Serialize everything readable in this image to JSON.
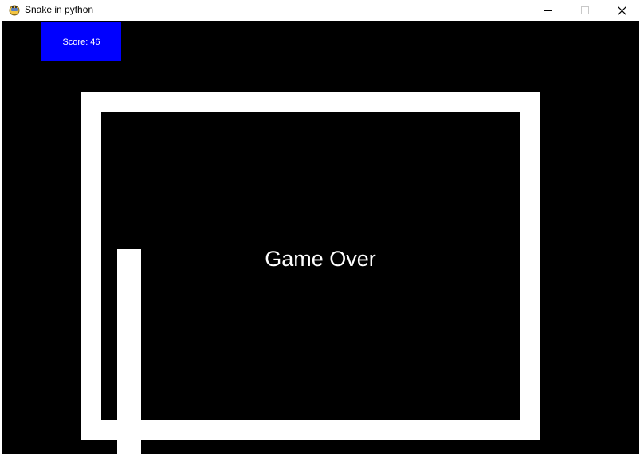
{
  "window": {
    "title": "Snake in python",
    "app_icon": "python-snake-icon",
    "controls": {
      "minimize_icon": "minimize-icon",
      "maximize_icon": "maximize-icon",
      "close_icon": "close-icon"
    }
  },
  "game": {
    "score_label": "Score: 46",
    "score_value": 46,
    "status_text": "Game Over",
    "colors": {
      "background": "#000000",
      "score_panel": "#0000ff",
      "walls": "#ffffff",
      "snake": "#ffffff",
      "text": "#ffffff"
    }
  }
}
